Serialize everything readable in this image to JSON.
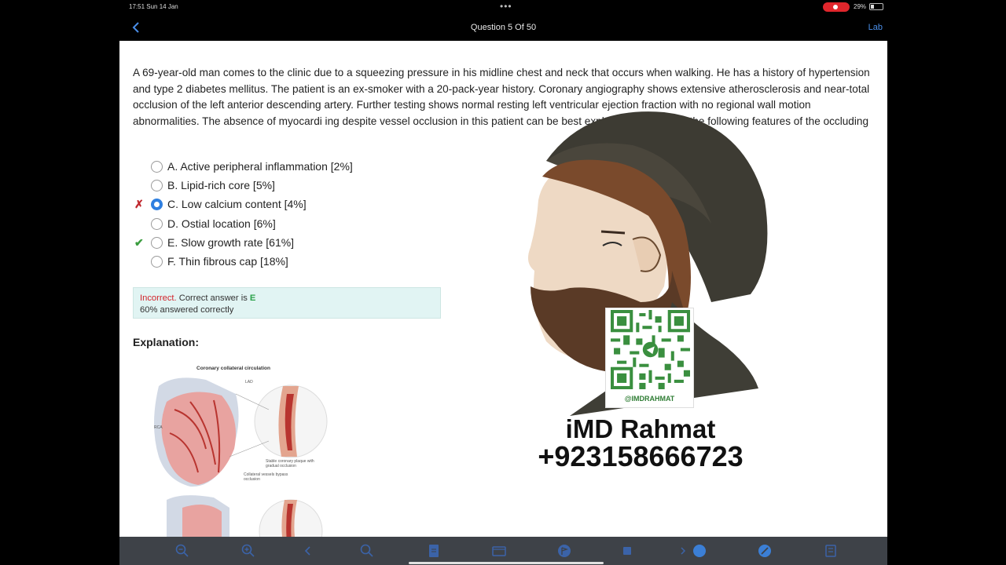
{
  "status_bar": {
    "time": "17:51  Sun 14 Jan",
    "dots": "•••",
    "battery": "29%"
  },
  "nav": {
    "title": "Question 5 Of 50",
    "lab_label": "Lab"
  },
  "question": {
    "stem": "A 69-year-old man comes to the clinic due to a squeezing pressure in his midline chest and neck that occurs when walking.  He has a history of hypertension and type 2 diabetes mellitus.  The patient is an ex-smoker with a 20-pack-year history.  Coronary angiography shows extensive atherosclerosis and near-total occlusion of the left anterior descending artery.  Further testing shows normal resting left ventricular ejection fraction with no regional wall motion abnormalities.  The absence of myocardi                              ing despite vessel occlusion in this patient can be best explained by which of the following features of the occluding"
  },
  "choices": [
    {
      "label": "A. Active peripheral inflammation [2%]",
      "mark": "",
      "selected": false
    },
    {
      "label": "B. Lipid-rich core [5%]",
      "mark": "",
      "selected": false
    },
    {
      "label": "C. Low calcium content [4%]",
      "mark": "✗",
      "selected": true
    },
    {
      "label": "D. Ostial location [6%]",
      "mark": "",
      "selected": false
    },
    {
      "label": "E. Slow growth rate [61%]",
      "mark": "✔",
      "selected": false
    },
    {
      "label": "F. Thin fibrous cap [18%]",
      "mark": "",
      "selected": false
    }
  ],
  "result": {
    "incorrect": "Incorrect.",
    "correct_prefix": " Correct answer is ",
    "correct_letter": "E",
    "percent_text": "60% answered correctly"
  },
  "explanation": {
    "heading": "Explanation:",
    "figure_title": "Coronary collateral circulation",
    "label_lad": "LAD",
    "label_rca": "RCA",
    "label_plaque": "Stable coronary plaque with gradual occlusion",
    "label_collateral": "Collateral vessels bypass occlusion"
  },
  "watermark": {
    "handle": "@IMDRAHMAT",
    "name": "iMD Rahmat",
    "phone": "+923158666723"
  },
  "toolbar": {
    "icons": [
      "zoom-out-icon",
      "zoom-in-icon",
      "previous-icon",
      "search-icon",
      "notes-icon",
      "tabs-icon",
      "flag-icon",
      "stop-icon",
      "next-icon",
      "highlight-icon",
      "calculator-icon"
    ]
  },
  "colors": {
    "accent": "#2f7fe0",
    "incorrect": "#d2232a",
    "correct": "#3b9d3f",
    "result_bg": "#e1f4f3"
  }
}
